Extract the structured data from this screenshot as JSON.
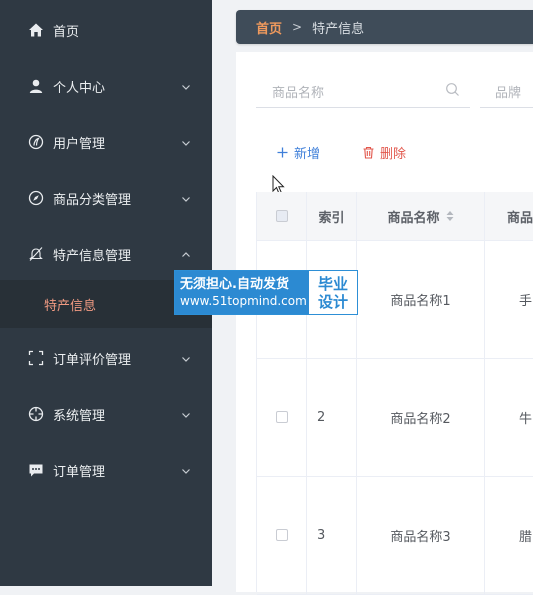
{
  "sidebar": {
    "items": [
      {
        "label": "首页",
        "icon": "home-icon"
      },
      {
        "label": "个人中心",
        "icon": "user-icon"
      },
      {
        "label": "用户管理",
        "icon": "user-manage-icon"
      },
      {
        "label": "商品分类管理",
        "icon": "compass-icon"
      },
      {
        "label": "特产信息管理",
        "icon": "bell-off-icon"
      },
      {
        "label": "订单评价管理",
        "icon": "frame-icon"
      },
      {
        "label": "系统管理",
        "icon": "crosshair-icon"
      },
      {
        "label": "订单管理",
        "icon": "chat-icon"
      }
    ],
    "subitem": {
      "label": "特产信息"
    }
  },
  "breadcrumb": {
    "home": "首页",
    "separator": ">",
    "current": "特产信息"
  },
  "search": {
    "name_placeholder": "商品名称",
    "brand_placeholder": "品牌"
  },
  "toolbar": {
    "add_label": "新增",
    "delete_label": "删除"
  },
  "table": {
    "headers": [
      "索引",
      "商品名称",
      "商品"
    ],
    "rows": [
      {
        "index": "",
        "name": "商品名称1",
        "brand": "手"
      },
      {
        "index": "2",
        "name": "商品名称2",
        "brand": "牛"
      },
      {
        "index": "3",
        "name": "商品名称3",
        "brand": "腊"
      }
    ]
  },
  "watermark": {
    "line1": "无须担心.自动发货",
    "line2": "www.51topmind.com",
    "badge1": "毕业",
    "badge2": "设计"
  },
  "colors": {
    "sidebar_bg": "#2f3943",
    "accent": "#f09a82",
    "primary": "#3f7fd9",
    "danger": "#e2574c"
  }
}
